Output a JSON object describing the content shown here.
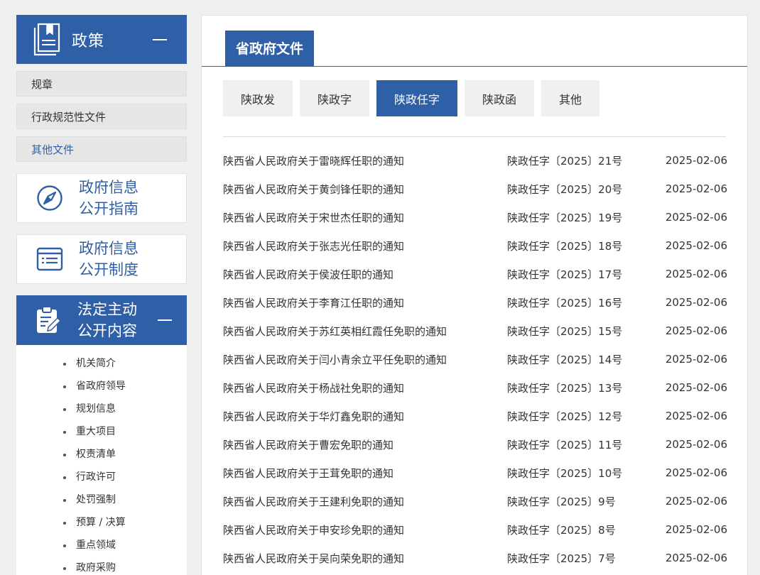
{
  "sidebar": {
    "policy_title": "政策",
    "policy_items": [
      {
        "label": "规章",
        "active": false
      },
      {
        "label": "行政规范性文件",
        "active": false
      },
      {
        "label": "其他文件",
        "active": true
      }
    ],
    "guide": {
      "line1": "政府信息",
      "line2": "公开指南"
    },
    "system": {
      "line1": "政府信息",
      "line2": "公开制度"
    },
    "law": {
      "line1": "法定主动",
      "line2": "公开内容",
      "items": [
        "机关简介",
        "省政府领导",
        "规划信息",
        "重大项目",
        "权责清单",
        "行政许可",
        "处罚强制",
        "预算 / 决算",
        "重点领域",
        "政府采购"
      ]
    }
  },
  "main": {
    "tab_title": "省政府文件",
    "subtabs": [
      {
        "label": "陕政发",
        "active": false
      },
      {
        "label": "陕政字",
        "active": false
      },
      {
        "label": "陕政任字",
        "active": true
      },
      {
        "label": "陕政函",
        "active": false
      },
      {
        "label": "其他",
        "active": false
      }
    ],
    "docs": [
      {
        "title": "陕西省人民政府关于雷晓辉任职的通知",
        "no": "陕政任字〔2025〕21号",
        "date": "2025-02-06"
      },
      {
        "title": "陕西省人民政府关于黄剑锋任职的通知",
        "no": "陕政任字〔2025〕20号",
        "date": "2025-02-06"
      },
      {
        "title": "陕西省人民政府关于宋世杰任职的通知",
        "no": "陕政任字〔2025〕19号",
        "date": "2025-02-06"
      },
      {
        "title": "陕西省人民政府关于张志光任职的通知",
        "no": "陕政任字〔2025〕18号",
        "date": "2025-02-06"
      },
      {
        "title": "陕西省人民政府关于侯波任职的通知",
        "no": "陕政任字〔2025〕17号",
        "date": "2025-02-06"
      },
      {
        "title": "陕西省人民政府关于李育江任职的通知",
        "no": "陕政任字〔2025〕16号",
        "date": "2025-02-06"
      },
      {
        "title": "陕西省人民政府关于苏红英相红霞任免职的通知",
        "no": "陕政任字〔2025〕15号",
        "date": "2025-02-06"
      },
      {
        "title": "陕西省人民政府关于闫小青余立平任免职的通知",
        "no": "陕政任字〔2025〕14号",
        "date": "2025-02-06"
      },
      {
        "title": "陕西省人民政府关于杨战社免职的通知",
        "no": "陕政任字〔2025〕13号",
        "date": "2025-02-06"
      },
      {
        "title": "陕西省人民政府关于华灯鑫免职的通知",
        "no": "陕政任字〔2025〕12号",
        "date": "2025-02-06"
      },
      {
        "title": "陕西省人民政府关于曹宏免职的通知",
        "no": "陕政任字〔2025〕11号",
        "date": "2025-02-06"
      },
      {
        "title": "陕西省人民政府关于王茸免职的通知",
        "no": "陕政任字〔2025〕10号",
        "date": "2025-02-06"
      },
      {
        "title": "陕西省人民政府关于王建利免职的通知",
        "no": "陕政任字〔2025〕9号",
        "date": "2025-02-06"
      },
      {
        "title": "陕西省人民政府关于申安珍免职的通知",
        "no": "陕政任字〔2025〕8号",
        "date": "2025-02-06"
      },
      {
        "title": "陕西省人民政府关于吴向荣免职的通知",
        "no": "陕政任字〔2025〕7号",
        "date": "2025-02-06"
      }
    ]
  },
  "colors": {
    "primary": "#2f5fa7",
    "tab_bg": "#f0f0f0",
    "page_bg": "#f0f0f0"
  },
  "icons": {
    "policy": "document-stack-icon",
    "guide": "compass-icon",
    "system": "window-list-icon",
    "law": "clipboard-pen-icon",
    "collapse": "minus-icon"
  }
}
